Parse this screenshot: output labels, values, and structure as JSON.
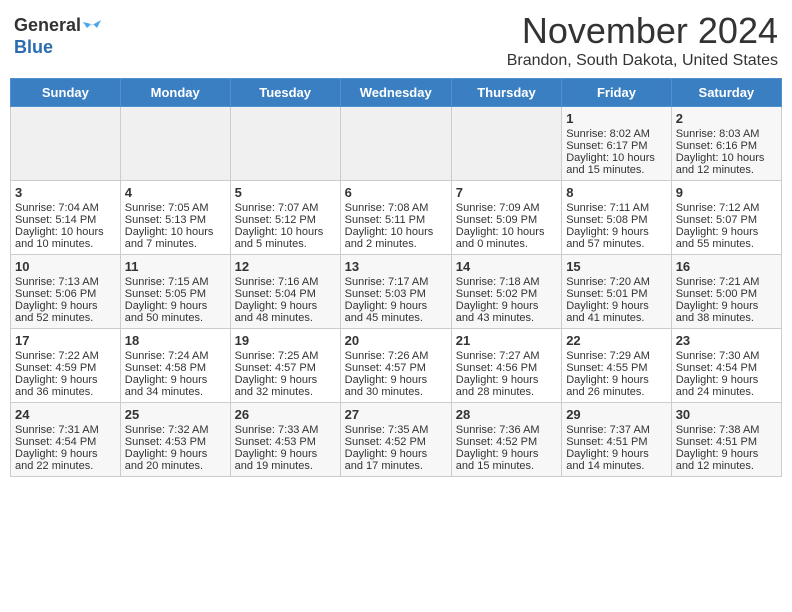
{
  "header": {
    "logo_general": "General",
    "logo_blue": "Blue",
    "month": "November 2024",
    "location": "Brandon, South Dakota, United States"
  },
  "days_of_week": [
    "Sunday",
    "Monday",
    "Tuesday",
    "Wednesday",
    "Thursday",
    "Friday",
    "Saturday"
  ],
  "weeks": [
    [
      {
        "day": "",
        "info": ""
      },
      {
        "day": "",
        "info": ""
      },
      {
        "day": "",
        "info": ""
      },
      {
        "day": "",
        "info": ""
      },
      {
        "day": "",
        "info": ""
      },
      {
        "day": "1",
        "info": "Sunrise: 8:02 AM\nSunset: 6:17 PM\nDaylight: 10 hours and 15 minutes."
      },
      {
        "day": "2",
        "info": "Sunrise: 8:03 AM\nSunset: 6:16 PM\nDaylight: 10 hours and 12 minutes."
      }
    ],
    [
      {
        "day": "3",
        "info": "Sunrise: 7:04 AM\nSunset: 5:14 PM\nDaylight: 10 hours and 10 minutes."
      },
      {
        "day": "4",
        "info": "Sunrise: 7:05 AM\nSunset: 5:13 PM\nDaylight: 10 hours and 7 minutes."
      },
      {
        "day": "5",
        "info": "Sunrise: 7:07 AM\nSunset: 5:12 PM\nDaylight: 10 hours and 5 minutes."
      },
      {
        "day": "6",
        "info": "Sunrise: 7:08 AM\nSunset: 5:11 PM\nDaylight: 10 hours and 2 minutes."
      },
      {
        "day": "7",
        "info": "Sunrise: 7:09 AM\nSunset: 5:09 PM\nDaylight: 10 hours and 0 minutes."
      },
      {
        "day": "8",
        "info": "Sunrise: 7:11 AM\nSunset: 5:08 PM\nDaylight: 9 hours and 57 minutes."
      },
      {
        "day": "9",
        "info": "Sunrise: 7:12 AM\nSunset: 5:07 PM\nDaylight: 9 hours and 55 minutes."
      }
    ],
    [
      {
        "day": "10",
        "info": "Sunrise: 7:13 AM\nSunset: 5:06 PM\nDaylight: 9 hours and 52 minutes."
      },
      {
        "day": "11",
        "info": "Sunrise: 7:15 AM\nSunset: 5:05 PM\nDaylight: 9 hours and 50 minutes."
      },
      {
        "day": "12",
        "info": "Sunrise: 7:16 AM\nSunset: 5:04 PM\nDaylight: 9 hours and 48 minutes."
      },
      {
        "day": "13",
        "info": "Sunrise: 7:17 AM\nSunset: 5:03 PM\nDaylight: 9 hours and 45 minutes."
      },
      {
        "day": "14",
        "info": "Sunrise: 7:18 AM\nSunset: 5:02 PM\nDaylight: 9 hours and 43 minutes."
      },
      {
        "day": "15",
        "info": "Sunrise: 7:20 AM\nSunset: 5:01 PM\nDaylight: 9 hours and 41 minutes."
      },
      {
        "day": "16",
        "info": "Sunrise: 7:21 AM\nSunset: 5:00 PM\nDaylight: 9 hours and 38 minutes."
      }
    ],
    [
      {
        "day": "17",
        "info": "Sunrise: 7:22 AM\nSunset: 4:59 PM\nDaylight: 9 hours and 36 minutes."
      },
      {
        "day": "18",
        "info": "Sunrise: 7:24 AM\nSunset: 4:58 PM\nDaylight: 9 hours and 34 minutes."
      },
      {
        "day": "19",
        "info": "Sunrise: 7:25 AM\nSunset: 4:57 PM\nDaylight: 9 hours and 32 minutes."
      },
      {
        "day": "20",
        "info": "Sunrise: 7:26 AM\nSunset: 4:57 PM\nDaylight: 9 hours and 30 minutes."
      },
      {
        "day": "21",
        "info": "Sunrise: 7:27 AM\nSunset: 4:56 PM\nDaylight: 9 hours and 28 minutes."
      },
      {
        "day": "22",
        "info": "Sunrise: 7:29 AM\nSunset: 4:55 PM\nDaylight: 9 hours and 26 minutes."
      },
      {
        "day": "23",
        "info": "Sunrise: 7:30 AM\nSunset: 4:54 PM\nDaylight: 9 hours and 24 minutes."
      }
    ],
    [
      {
        "day": "24",
        "info": "Sunrise: 7:31 AM\nSunset: 4:54 PM\nDaylight: 9 hours and 22 minutes."
      },
      {
        "day": "25",
        "info": "Sunrise: 7:32 AM\nSunset: 4:53 PM\nDaylight: 9 hours and 20 minutes."
      },
      {
        "day": "26",
        "info": "Sunrise: 7:33 AM\nSunset: 4:53 PM\nDaylight: 9 hours and 19 minutes."
      },
      {
        "day": "27",
        "info": "Sunrise: 7:35 AM\nSunset: 4:52 PM\nDaylight: 9 hours and 17 minutes."
      },
      {
        "day": "28",
        "info": "Sunrise: 7:36 AM\nSunset: 4:52 PM\nDaylight: 9 hours and 15 minutes."
      },
      {
        "day": "29",
        "info": "Sunrise: 7:37 AM\nSunset: 4:51 PM\nDaylight: 9 hours and 14 minutes."
      },
      {
        "day": "30",
        "info": "Sunrise: 7:38 AM\nSunset: 4:51 PM\nDaylight: 9 hours and 12 minutes."
      }
    ]
  ]
}
